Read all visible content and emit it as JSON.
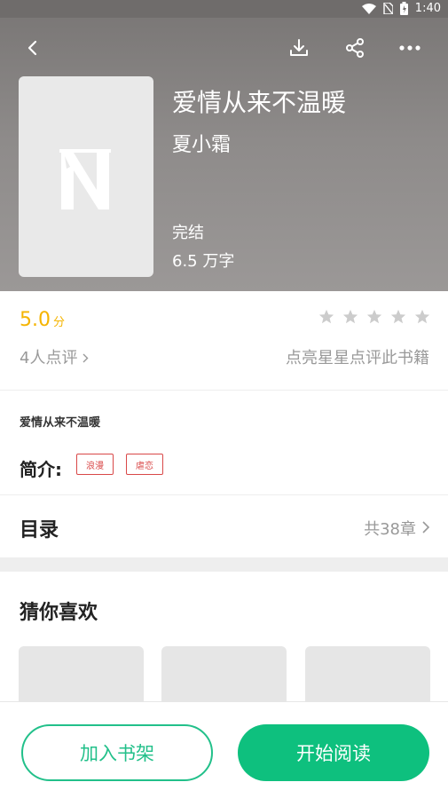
{
  "statusbar": {
    "time": "1:40"
  },
  "book": {
    "title": "爱情从来不温暖",
    "author": "夏小霜",
    "status": "完结",
    "word_count": "6.5 万字"
  },
  "rating": {
    "score": "5.0",
    "score_unit": "分",
    "stars_total": 5,
    "stars_filled": 0,
    "reviews": "4人点评",
    "hint": "点亮星星点评此书籍"
  },
  "intro": {
    "title": "爱情从来不温暖",
    "label": "简介:",
    "tags": [
      "浪漫",
      "虐恋"
    ]
  },
  "toc": {
    "title": "目录",
    "count": "共38章"
  },
  "recommend": {
    "title": "猜你喜欢"
  },
  "actions": {
    "add_shelf": "加入书架",
    "start_reading": "开始阅读"
  },
  "colors": {
    "accent_green": "#0ec07e",
    "score_yellow": "#f5b400",
    "tag_red": "#d94848"
  },
  "icons": [
    "back-icon",
    "download-icon",
    "share-icon",
    "more-icon",
    "star-icon",
    "chevron-right-icon"
  ]
}
